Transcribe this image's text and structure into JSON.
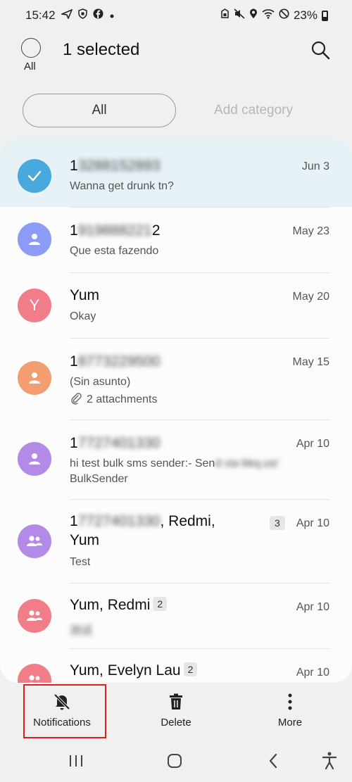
{
  "status_bar": {
    "time": "15:42",
    "left_icons": [
      "navigation-icon",
      "shield-icon",
      "facebook-icon",
      "dot-icon"
    ],
    "right_icons": [
      "lock-icon",
      "mute-icon",
      "location-icon",
      "wifi-icon",
      "do-not-disturb-icon"
    ],
    "battery": "23%"
  },
  "header": {
    "all_label": "All",
    "title": "1 selected",
    "search_icon": "search-icon"
  },
  "categories": {
    "active": "All",
    "add": "Add category"
  },
  "conversations": [
    {
      "name_prefix": "1",
      "name_blurred": "3288152893",
      "name_suffix": "",
      "date": "Jun 3",
      "preview": "Wanna get drunk tn?",
      "selected": true,
      "avatar_color": "#4aa9dc",
      "avatar_type": "check"
    },
    {
      "name_prefix": "1",
      "name_blurred": "919888221",
      "name_suffix": "2",
      "date": "May 23",
      "preview": "Que esta fazendo",
      "selected": false,
      "avatar_color": "#8c9bf5",
      "avatar_type": "person"
    },
    {
      "name_prefix": "",
      "name_blurred": "",
      "name_suffix": "Yum",
      "date": "May 20",
      "preview": "Okay",
      "selected": false,
      "avatar_color": "#f17d88",
      "avatar_type": "letter",
      "avatar_letter": "Y"
    },
    {
      "name_prefix": "1",
      "name_blurred": "8773229500",
      "name_suffix": "",
      "date": "May 15",
      "preview": "(Sin asunto)",
      "attachments": "2 attachments",
      "selected": false,
      "avatar_color": "#f59d72",
      "avatar_type": "person"
    },
    {
      "name_prefix": "1",
      "name_blurred": "7727401330",
      "name_suffix": "",
      "date": "Apr 10",
      "preview": "hi test bulk sms sender:- Sen",
      "preview_blurred": "d via bkq.us/",
      "preview2": "BulkSender",
      "selected": false,
      "avatar_color": "#b48ae8",
      "avatar_type": "person"
    },
    {
      "name_prefix": "1",
      "name_blurred": "7727401330",
      "name_suffix": ", Redmi,",
      "name_line2": "Yum",
      "badge": "3",
      "date": "Apr 10",
      "preview": "Test",
      "selected": false,
      "avatar_color": "#b48ae8",
      "avatar_type": "group"
    },
    {
      "name_prefix": "",
      "name_blurred": "",
      "name_suffix": "Yum, Redmi",
      "badge": "2",
      "date": "Apr 10",
      "preview_blurred": "测试",
      "selected": false,
      "avatar_color": "#f17d88",
      "avatar_type": "group"
    },
    {
      "name_prefix": "",
      "name_blurred": "",
      "name_suffix": "Yum, Evelyn Lau",
      "badge": "2",
      "date": "Apr 10",
      "selected": false,
      "avatar_color": "#f17d88",
      "avatar_type": "group"
    }
  ],
  "actions": {
    "notifications": "Notifications",
    "delete": "Delete",
    "more": "More"
  },
  "navbar": {
    "recents_icon": "recents-icon",
    "home_icon": "home-icon",
    "back_icon": "back-icon",
    "accessibility_icon": "accessibility-icon"
  }
}
